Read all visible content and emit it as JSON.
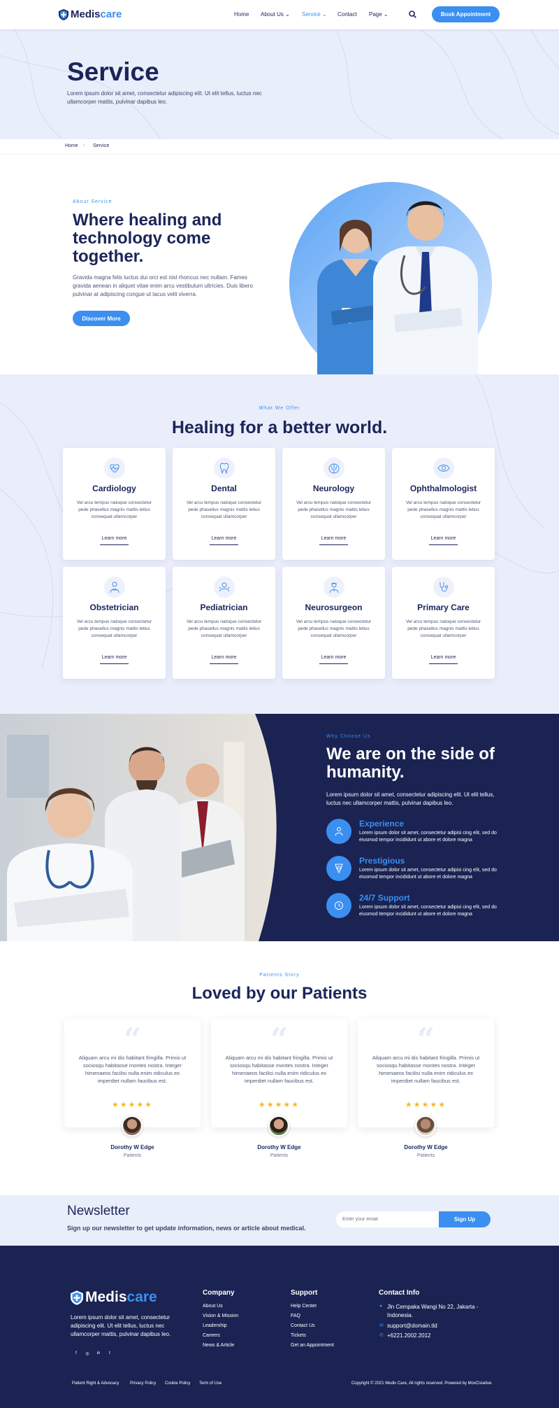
{
  "brand": {
    "name_part1": "Medis",
    "name_part2": "care"
  },
  "nav": {
    "items": [
      "Home",
      "About Us",
      "Service",
      "Contact",
      "Page"
    ],
    "active": "Service",
    "cta": "Book Appointment"
  },
  "hero": {
    "title": "Service",
    "text": "Lorem ipsum dolor sit amet, consectetur adipiscing elit. Ut elit tellus, luctus nec ullamcorper mattis, pulvinar dapibus leo."
  },
  "breadcrumb": {
    "home": "Home",
    "current": "Service"
  },
  "about": {
    "eyebrow": "About Service",
    "title": "Where healing and technology come together.",
    "text": "Gravida magna felis luctus dui orci est nisl rhoncus nec nullam. Fames gravida aenean in aliquet vitae enim arcu vestibulum ultricies. Duis libero pulvinar at adipiscing congue ut lacus velit viverra.",
    "button": "Discover More"
  },
  "offer": {
    "eyebrow": "What We Offer",
    "title": "Healing for a better world.",
    "cards": [
      {
        "title": "Cardiology",
        "text": "Vel arcu tempus natoque consectetur pede phasellus magnis mattis letius consequat ullamcorper",
        "link": "Learn more",
        "icon": "heart-pulse-icon"
      },
      {
        "title": "Dental",
        "text": "Vel arcu tempus natoque consectetur pede phasellus magnis mattis letius consequat ullamcorper",
        "link": "Learn more",
        "icon": "tooth-icon"
      },
      {
        "title": "Neurology",
        "text": "Vel arcu tempus natoque consectetur pede phasellus magnis mattis letius consequat ullamcorper",
        "link": "Learn more",
        "icon": "brain-icon"
      },
      {
        "title": "Ophthalmologist",
        "text": "Vel arcu tempus natoque consectetur pede phasellus magnis mattis letius consequat ullamcorper",
        "link": "Learn more",
        "icon": "eye-icon"
      },
      {
        "title": "Obstetrician",
        "text": "Vel arcu tempus natoque consectetur pede phasellus magnis mattis letius consequat ullamcorper",
        "link": "Learn more",
        "icon": "obstetrician-icon"
      },
      {
        "title": "Pediatrician",
        "text": "Vel arcu tempus natoque consectetur pede phasellus magnis mattis letius consequat ullamcorper",
        "link": "Learn more",
        "icon": "baby-icon"
      },
      {
        "title": "Neurosurgeon",
        "text": "Vel arcu tempus natoque consectetur pede phasellus magnis mattis letius consequat ullamcorper",
        "link": "Learn more",
        "icon": "surgeon-icon"
      },
      {
        "title": "Primary Care",
        "text": "Vel arcu tempus natoque consectetur pede phasellus magnis mattis letius consequat ullamcorper",
        "link": "Learn more",
        "icon": "stethoscope-icon"
      }
    ]
  },
  "why": {
    "eyebrow": "Why Choose Us",
    "title": "We are on the side of humanity.",
    "text": "Lorem ipsum dolor sit amet, consectetur adipiscing elit. Ut elit tellus, luctus nec ullamcorper mattis, pulvinar dapibus leo.",
    "features": [
      {
        "title": "Experience",
        "text": "Lorem ipsum dolor sit amet, consectetur adipisi cing elit, sed do eiusmod tempor incididunt ut abore et dolore magna"
      },
      {
        "title": "Prestigious",
        "text": "Lorem ipsum dolor sit amet, consectetur adipisi cing elit, sed do eiusmod tempor incididunt ut abore et dolore magna"
      },
      {
        "title": "24/7 Support",
        "text": "Lorem ipsum dolor sit amet, consectetur adipisi cing elit, sed do eiusmod tempor incididunt ut abore et dolore magna"
      }
    ]
  },
  "testimonials": {
    "eyebrow": "Patients Story",
    "title": "Loved by our Patients",
    "items": [
      {
        "text": "Aliquam arcu mi dis habitant fringilla. Primis ut sociosqu habitasse montes nostra. Integer himenaeos facilisi nulla enim ridiculus ex imperdiet nullam faucibus est.",
        "stars": "★★★★★",
        "name": "Dorothy W Edge",
        "role": "Patients"
      },
      {
        "text": "Aliquam arcu mi dis habitant fringilla. Primis ut sociosqu habitasse montes nostra. Integer himenaeos facilisi nulla enim ridiculus ex imperdiet nullam faucibus est.",
        "stars": "★★★★★",
        "name": "Dorothy W Edge",
        "role": "Patients"
      },
      {
        "text": "Aliquam arcu mi dis habitant fringilla. Primis ut sociosqu habitasse montes nostra. Integer himenaeos facilisi nulla enim ridiculus ex imperdiet nullam faucibus est.",
        "stars": "★★★★★",
        "name": "Dorothy W Edge",
        "role": "Patients"
      }
    ]
  },
  "newsletter": {
    "title": "Newsletter",
    "text": "Sign up our newsletter to get update information, news or article about medical.",
    "placeholder": "Enter your email",
    "button": "Sign Up"
  },
  "footer": {
    "about": "Lorem ipsum dolor sit amet, consectetur adipiscing elit. Ut elit tellus, luctus nec ullamcorper mattis, pulvinar dapibus leo.",
    "company": {
      "title": "Company",
      "links": [
        "About Us",
        "Vision & Mission",
        "Leadership",
        "Careers",
        "News & Article"
      ]
    },
    "support": {
      "title": "Support",
      "links": [
        "Help Center",
        "FAQ",
        "Contact Us",
        "Tickets",
        "Get an Appointment"
      ]
    },
    "contact": {
      "title": "Contact Info",
      "address": "Jln Cempaka Wangi No 22, Jakarta - Indonesia.",
      "email": "support@domain.tld",
      "phone": "+6221.2002.2012"
    },
    "bottom_links": [
      "Patient Right & Advocacy",
      "Privacy Policy",
      "Cookie Policy",
      "Term of Use"
    ],
    "copyright": "Copyright © 2021 Medis Care, All rights reserved. Powered by MoxCreative."
  },
  "colors": {
    "primary": "#3b8ff0",
    "navy": "#1a2352",
    "light_bg": "#e9eefb",
    "star": "#f5b82e"
  }
}
